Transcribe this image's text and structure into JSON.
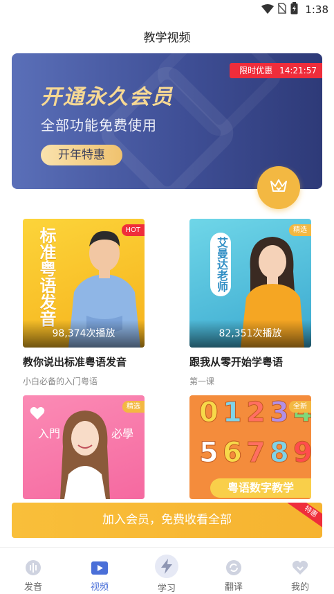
{
  "status_bar": {
    "time": "1:38"
  },
  "header": {
    "title": "教学视频"
  },
  "banner": {
    "promo_label": "限时优惠",
    "countdown": "14:21:57",
    "title": "开通永久会员",
    "subtitle": "全部功能免费使用",
    "button_label": "开年特惠"
  },
  "cards": [
    {
      "title": "教你说出标准粤语发音",
      "subtitle": "小白必备的入门粤语",
      "plays": "98,374次播放",
      "badge": "HOT",
      "thumb_text": "标准粤语发音",
      "badge_color": "#ef2d3b"
    },
    {
      "title": "跟我从零开始学粤语",
      "subtitle": "第一课",
      "plays": "82,351次播放",
      "badge": "精选",
      "thumb_text": "艾曼达老师",
      "badge_color": "#f3b842"
    },
    {
      "badge": "精选",
      "thumb_text_left": "入門",
      "thumb_text_right": "必學",
      "badge_color": "#f3b842"
    },
    {
      "badge": "全新",
      "thumb_digits": "0123456789",
      "thumb_caption": "粤语数字教学",
      "badge_color": "#f3b842"
    }
  ],
  "cta": {
    "label": "加入会员，免费收看全部",
    "corner": "特惠"
  },
  "tabbar": {
    "items": [
      {
        "label": "发音",
        "icon": "sound-wave-icon"
      },
      {
        "label": "视频",
        "icon": "video-play-icon"
      },
      {
        "label": "学习",
        "icon": "lightning-icon"
      },
      {
        "label": "翻译",
        "icon": "refresh-icon"
      },
      {
        "label": "我的",
        "icon": "heart-icon"
      }
    ],
    "active_index": 1
  },
  "colors": {
    "accent": "#4a6fd8",
    "gold": "#f3b842",
    "red": "#ef2d3b"
  }
}
